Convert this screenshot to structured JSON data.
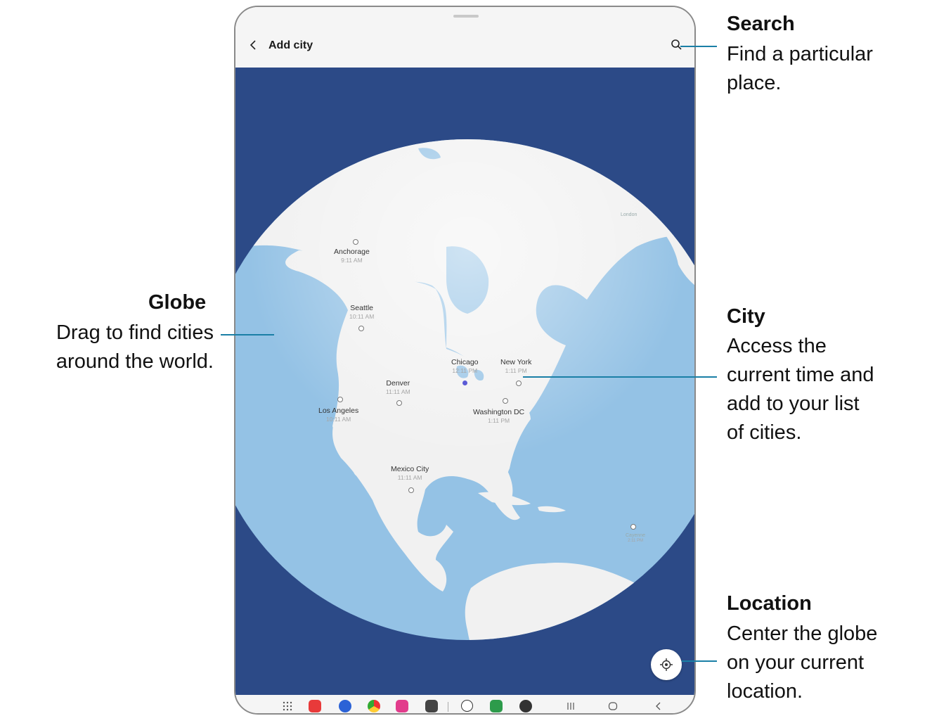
{
  "app": {
    "title": "Add city"
  },
  "cities": [
    {
      "name": "Anchorage",
      "time": "9:11 AM"
    },
    {
      "name": "Seattle",
      "time": "10:11 AM"
    },
    {
      "name": "Chicago",
      "time": "12:11 PM"
    },
    {
      "name": "New York",
      "time": "1:11 PM"
    },
    {
      "name": "Denver",
      "time": "11:11 AM"
    },
    {
      "name": "Los Angeles",
      "time": "10:11 AM"
    },
    {
      "name": "Washington DC",
      "time": "1:11 PM"
    },
    {
      "name": "Mexico City",
      "time": "11:11 AM"
    },
    {
      "name": "London",
      "time": ""
    },
    {
      "name": "Cayenne",
      "time": "2:11 PM"
    }
  ],
  "callouts": {
    "search": {
      "title": "Search",
      "lines": [
        "Find a particular",
        "place."
      ]
    },
    "globe": {
      "title": "Globe",
      "lines": [
        "Drag to find cities",
        "around the world."
      ]
    },
    "city": {
      "title": "City",
      "lines": [
        "Access the",
        "current time and",
        "add to your list",
        "of cities."
      ]
    },
    "location": {
      "title": "Location",
      "lines": [
        "Center the globe",
        "on your current",
        "location."
      ]
    }
  },
  "colors": {
    "ocean_background": "#2c4a87",
    "globe_water": "#94c2e5",
    "land": "#f1f1f1",
    "callout_line": "#1a7fa6"
  },
  "icons": [
    "back-icon",
    "search-icon",
    "location-icon",
    "apps-grid-icon",
    "recents-icon",
    "home-icon",
    "nav-back-icon"
  ]
}
